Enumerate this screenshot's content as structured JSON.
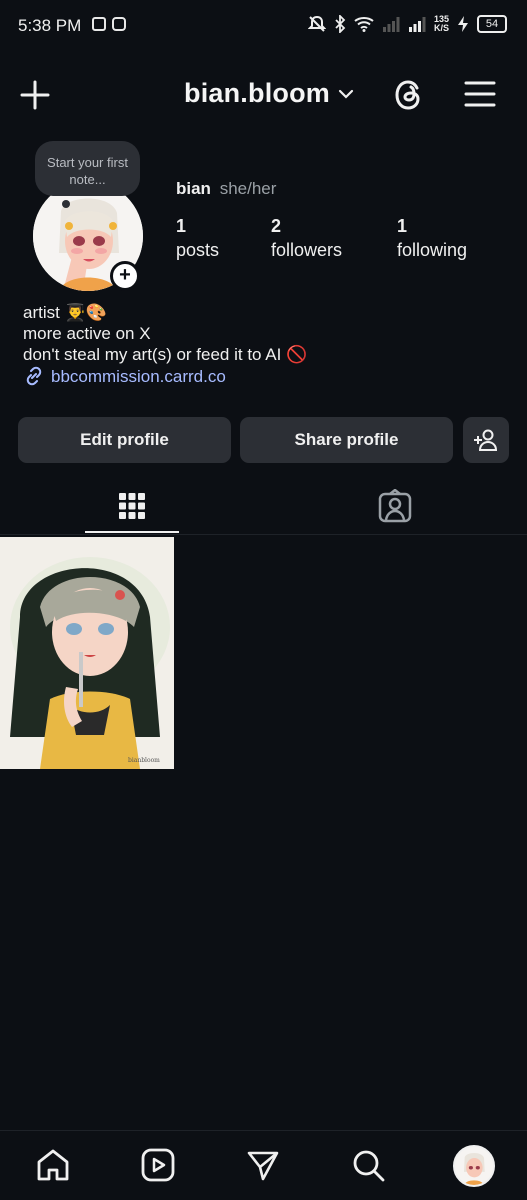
{
  "status_bar": {
    "time": "5:38 PM",
    "left_icons": [
      "news-icon",
      "instagram-icon"
    ],
    "right_icons": [
      "mute-icon",
      "bluetooth-icon",
      "wifi-icon",
      "signal-icon",
      "signal-icon-2"
    ],
    "net_speed_value": "135",
    "net_speed_unit": "K/S",
    "battery": "54"
  },
  "header": {
    "username": "bian.bloom",
    "icons": [
      "plus-icon",
      "chevron-down-icon",
      "threads-icon",
      "menu-icon"
    ]
  },
  "profile": {
    "note_placeholder": "Start your first note...",
    "display_name": "bian",
    "pronouns": "she/her",
    "stats": [
      {
        "value": "1",
        "label": "posts"
      },
      {
        "value": "2",
        "label": "followers"
      },
      {
        "value": "1",
        "label": "following"
      }
    ],
    "bio": [
      "artist 👨‍🎓🎨",
      "more active on X",
      "don't steal my art(s) or feed it to AI 🚫"
    ],
    "link": "bbcommission.carrd.co"
  },
  "buttons": {
    "edit_profile": "Edit profile",
    "share_profile": "Share profile"
  },
  "tabs": [
    "grid-icon",
    "tagged-icon"
  ],
  "grid": {
    "posts": [
      {
        "kind": "artwork",
        "signature": "bianbloom"
      }
    ]
  },
  "bottom_nav": [
    "home-icon",
    "reels-icon",
    "direct-icon",
    "search-icon",
    "profile-avatar"
  ],
  "colors": {
    "background": "#0c0f14",
    "surface": "#2c2f35",
    "link": "#a7bbff",
    "muted": "#9aa0a6"
  }
}
